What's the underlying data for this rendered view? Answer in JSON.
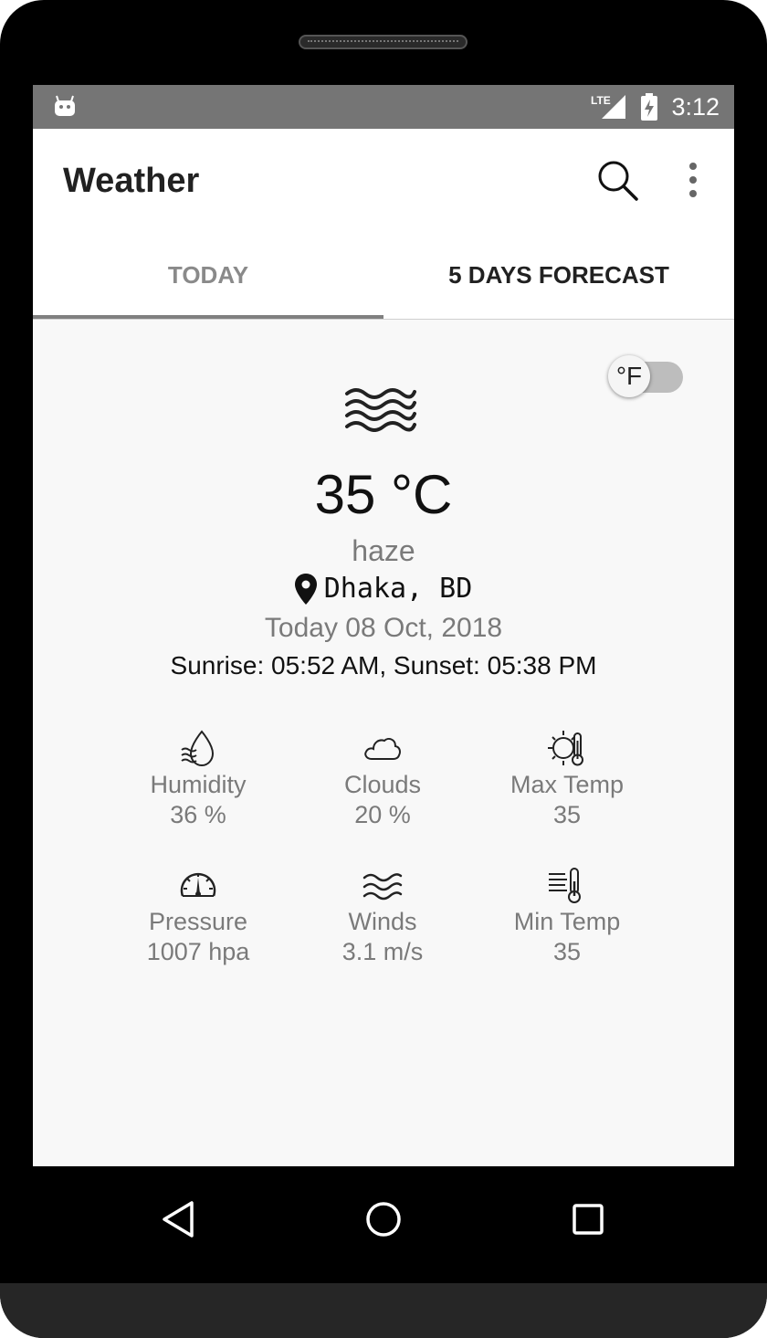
{
  "status_bar": {
    "network": "LTE",
    "time": "3:12"
  },
  "app_bar": {
    "title": "Weather"
  },
  "tabs": [
    {
      "label": "TODAY"
    },
    {
      "label": "5 DAYS FORECAST"
    }
  ],
  "unit_toggle": {
    "label": "°F",
    "enabled": false
  },
  "current": {
    "icon": "haze-icon",
    "temperature": "35 °C",
    "condition": "haze",
    "location": "Dhaka, BD",
    "date": "Today 08 Oct, 2018",
    "sun_times": "Sunrise: 05:52 AM, Sunset: 05:38 PM"
  },
  "stats": [
    {
      "icon": "humidity-icon",
      "label": "Humidity",
      "value": "36 %"
    },
    {
      "icon": "cloud-icon",
      "label": "Clouds",
      "value": "20 %"
    },
    {
      "icon": "max-temp-icon",
      "label": "Max Temp",
      "value": "35"
    },
    {
      "icon": "pressure-gauge-icon",
      "label": "Pressure",
      "value": "1007 hpa"
    },
    {
      "icon": "wind-icon",
      "label": "Winds",
      "value": "3.1 m/s"
    },
    {
      "icon": "min-temp-icon",
      "label": "Min Temp",
      "value": "35"
    }
  ],
  "colors": {
    "status_bar": "#757575",
    "tab_indicator": "#808080",
    "background": "#f8f8f8"
  }
}
